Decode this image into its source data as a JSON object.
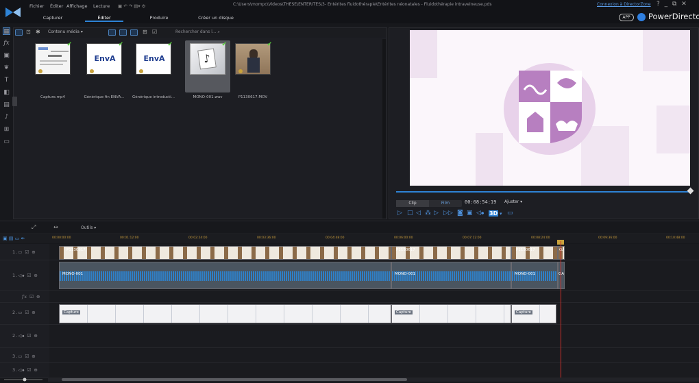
{
  "menu": {
    "file": "Fichier",
    "edit": "Éditer",
    "view": "Affichage",
    "play": "Lecture"
  },
  "tabs": {
    "capture": "Capturer",
    "edit": "Éditer",
    "produce": "Produire",
    "disc": "Créer un disque"
  },
  "window": {
    "path": "C:\\Users\\mompc\\Videos\\THESE\\ENTERITES\\3- Entérites fluidothérapie\\Entérites néonatales - Fluidothérapie intraveineuse.pds",
    "connect": "Connexion à DirectorZone",
    "controls": "?  _  ⧉  ✕",
    "app_badge": "APP",
    "brand": "PowerDirector"
  },
  "library": {
    "content_selector": "Contenu média",
    "search_placeholder": "Rechercher dans l...",
    "items": [
      {
        "caption": "Capture.mp4",
        "thumb": "doc"
      },
      {
        "caption": "Générique fin ENVA...",
        "thumb": "enva",
        "logo": "EnvA"
      },
      {
        "caption": "Générique introducti...",
        "thumb": "enva",
        "logo": "EnvA"
      },
      {
        "caption": "MONO-001.wav",
        "thumb": "audio"
      },
      {
        "caption": "P1130617.MOV",
        "thumb": "video"
      }
    ]
  },
  "preview": {
    "clip_label": "Clip",
    "film_label": "Film",
    "timecode": "00:08:54:19",
    "fit_label": "Ajuster",
    "speed_badge": "3D",
    "progress": 0.99
  },
  "toolbar": {
    "tools_label": "Outils"
  },
  "ruler": {
    "marks": [
      "00:00:00:00",
      "00:01:12:00",
      "00:02:24:00",
      "00:03:36:00",
      "00:04:48:00",
      "00:06:00:00",
      "00:07:12:00",
      "00:08:24:00",
      "00:09:36:00",
      "00:10:48:00"
    ]
  },
  "tracks": [
    {
      "label": "1.",
      "type": "video"
    },
    {
      "label": "1.",
      "type": "audio"
    },
    {
      "label": "fx",
      "type": "fx"
    },
    {
      "label": "2.",
      "type": "video"
    },
    {
      "label": "2.",
      "type": "audio"
    },
    {
      "label": "3.",
      "type": "video"
    },
    {
      "label": "3.",
      "type": "audio"
    }
  ],
  "clips": {
    "video1": [
      "P1130617",
      "P1130617",
      "P1130617",
      "GA"
    ],
    "audio1": [
      "MONO-001",
      "MONO-001",
      "MONO-001",
      "GA"
    ],
    "video2": [
      "Capture",
      "Capture",
      "Capture"
    ]
  },
  "colors": {
    "accent": "#2e83d6",
    "playhead": "#d0302a",
    "logo_purple": "#b77fc0",
    "check_green": "#57d33a"
  }
}
